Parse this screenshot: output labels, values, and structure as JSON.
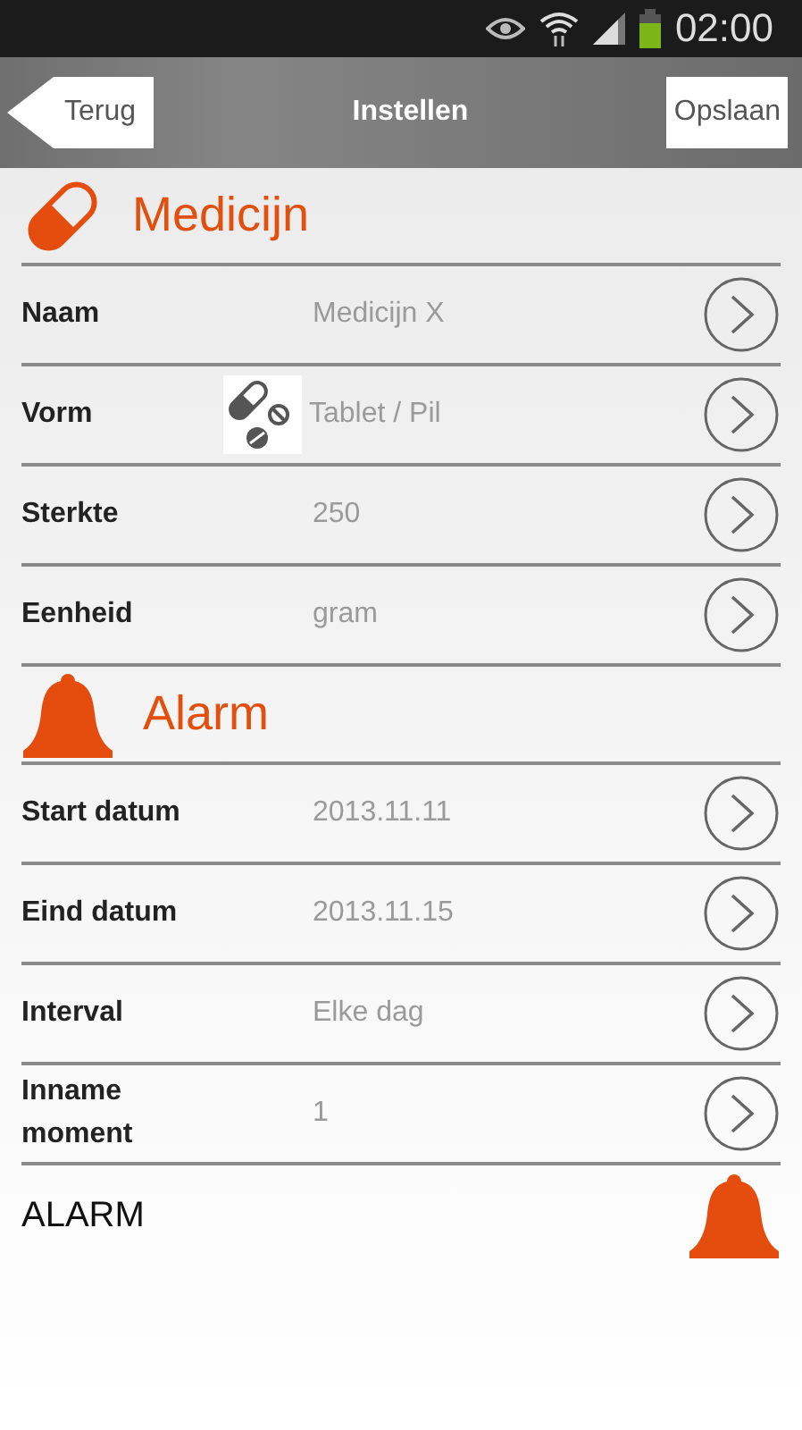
{
  "status_bar": {
    "time": "02:00"
  },
  "header": {
    "back": "Terug",
    "title": "Instellen",
    "save": "Opslaan"
  },
  "sections": [
    {
      "title": "Medicijn",
      "kind": "pill",
      "rows": [
        {
          "label": "Naam",
          "value": "Medicijn X",
          "kind": "text"
        },
        {
          "label": "Vorm",
          "value": "Tablet / Pil",
          "kind": "form"
        },
        {
          "label": "Sterkte",
          "value": "250",
          "kind": "text"
        },
        {
          "label": "Eenheid",
          "value": "gram",
          "kind": "text"
        }
      ]
    },
    {
      "title": "Alarm",
      "kind": "bell",
      "rows": [
        {
          "label": "Start datum",
          "value": "2013.11.11",
          "kind": "text"
        },
        {
          "label": "Eind datum",
          "value": "2013.11.15",
          "kind": "text"
        },
        {
          "label": "Interval",
          "value": "Elke dag",
          "kind": "text"
        },
        {
          "label": "Inname moment",
          "value": "1",
          "kind": "text"
        }
      ]
    }
  ],
  "alarm": {
    "label": "ALARM"
  }
}
